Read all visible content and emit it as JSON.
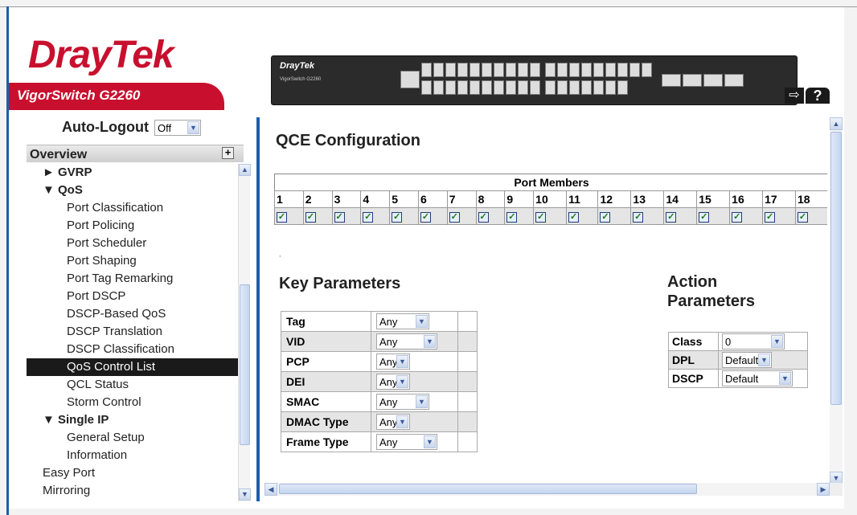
{
  "header": {
    "logo_part1": "Dray",
    "logo_part2": "Tek",
    "product_name": "VigorSwitch G2260",
    "device_logo": "DrayTek",
    "device_model": "VigorSwitch G2260",
    "logout_icon": "logout-icon",
    "help_label": "?"
  },
  "sidebar": {
    "autologout_label": "Auto-Logout",
    "autologout_value": "Off",
    "overview_label": "Overview",
    "items": [
      {
        "label": "► GVRP",
        "kind": "group"
      },
      {
        "label": "▼ QoS",
        "kind": "group"
      },
      {
        "label": "Port Classification",
        "kind": "sub"
      },
      {
        "label": "Port Policing",
        "kind": "sub"
      },
      {
        "label": "Port Scheduler",
        "kind": "sub"
      },
      {
        "label": "Port Shaping",
        "kind": "sub"
      },
      {
        "label": "Port Tag Remarking",
        "kind": "sub"
      },
      {
        "label": "Port DSCP",
        "kind": "sub"
      },
      {
        "label": "DSCP-Based QoS",
        "kind": "sub"
      },
      {
        "label": "DSCP Translation",
        "kind": "sub"
      },
      {
        "label": "DSCP Classification",
        "kind": "sub"
      },
      {
        "label": "QoS Control List",
        "kind": "sub",
        "active": true
      },
      {
        "label": "QCL Status",
        "kind": "sub"
      },
      {
        "label": "Storm Control",
        "kind": "sub"
      },
      {
        "label": "▼ Single IP",
        "kind": "group"
      },
      {
        "label": "General Setup",
        "kind": "sub"
      },
      {
        "label": "Information",
        "kind": "sub"
      },
      {
        "label": "Easy Port",
        "kind": "top"
      },
      {
        "label": "Mirroring",
        "kind": "top"
      }
    ]
  },
  "content": {
    "title": "QCE Configuration",
    "port_members_label": "Port Members",
    "ports": [
      "1",
      "2",
      "3",
      "4",
      "5",
      "6",
      "7",
      "8",
      "9",
      "10",
      "11",
      "12",
      "13",
      "14",
      "15",
      "16",
      "17",
      "18"
    ],
    "ports_checked": true,
    "dot": ",",
    "key_title": "Key Parameters",
    "key_params": [
      {
        "label": "Tag",
        "value": "Any"
      },
      {
        "label": "VID",
        "value": "Any"
      },
      {
        "label": "PCP",
        "value": "Any"
      },
      {
        "label": "DEI",
        "value": "Any"
      },
      {
        "label": "SMAC",
        "value": "Any"
      },
      {
        "label": "DMAC Type",
        "value": "Any"
      },
      {
        "label": "Frame Type",
        "value": "Any"
      }
    ],
    "action_title_line1": "Action",
    "action_title_line2": "Parameters",
    "action_params": [
      {
        "label": "Class",
        "value": "0"
      },
      {
        "label": "DPL",
        "value": "Default"
      },
      {
        "label": "DSCP",
        "value": "Default"
      }
    ]
  },
  "colors": {
    "brand_red": "#c8102e",
    "accent_blue": "#1b5fae",
    "active_bg": "#1a1a1a"
  }
}
